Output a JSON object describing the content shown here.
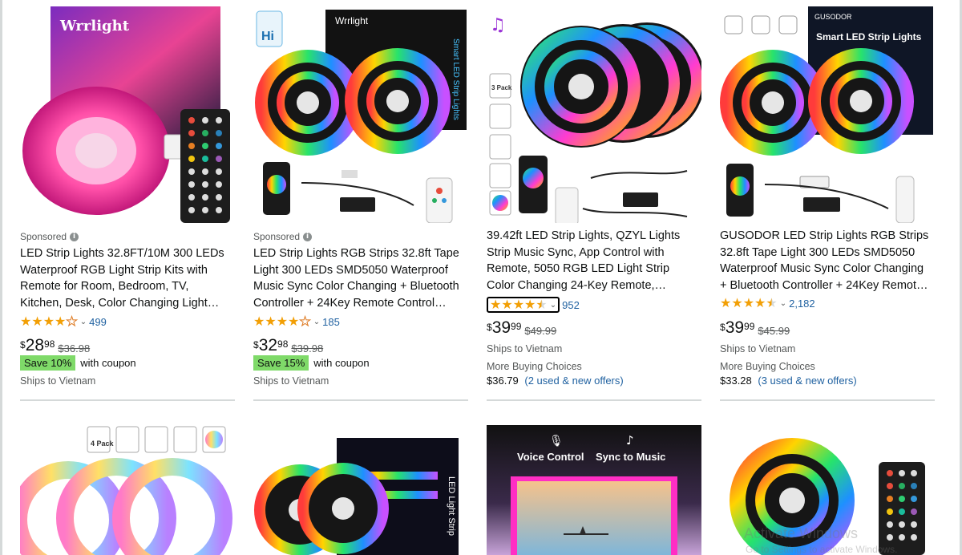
{
  "products": [
    {
      "brand_text": "Wrrlight",
      "sponsored": "Sponsored",
      "title": "LED Strip Lights 32.8FT/10M 300 LEDs Waterproof RGB Light Strip Kits with Remote for Room, Bedroom, TV, Kitchen, Desk, Color Changing Light…",
      "rating": 4.0,
      "review_count": "499",
      "price_symbol": "$",
      "price_whole": "28",
      "price_fraction": "98",
      "list_price": "$36.98",
      "coupon_badge": "Save 10%",
      "coupon_text": "with coupon",
      "ships": "Ships to Vietnam"
    },
    {
      "brand_text": "Wrrlight",
      "badge_text": "Hi",
      "box_text": "Smart LED Strip Lights",
      "sponsored": "Sponsored",
      "title": "LED Strip Lights RGB Strips 32.8ft Tape Light 300 LEDs SMD5050 Waterproof Music Sync Color Changing + Bluetooth Controller + 24Key Remote Control…",
      "rating": 4.0,
      "review_count": "185",
      "price_symbol": "$",
      "price_whole": "32",
      "price_fraction": "98",
      "list_price": "$39.98",
      "coupon_badge": "Save 15%",
      "coupon_text": "with coupon",
      "ships": "Ships to Vietnam"
    },
    {
      "pack_badge": "3 Pack",
      "title": "39.42ft LED Strip Lights, QZYL Lights Strip Music Sync, App Control with Remote, 5050 RGB LED Light Strip Color Changing 24-Key Remote,…",
      "rating": 4.5,
      "review_count": "952",
      "price_symbol": "$",
      "price_whole": "39",
      "price_fraction": "99",
      "list_price": "$49.99",
      "ships": "Ships to Vietnam",
      "more_buying": "More Buying Choices",
      "offer_price": "$36.79",
      "offers_link": "(2 used & new offers)"
    },
    {
      "brand_text": "GUSODOR",
      "box_text": "Smart LED Strip Lights",
      "title": "GUSODOR LED Strip Lights RGB Strips 32.8ft Tape Light 300 LEDs SMD5050 Waterproof Music Sync Color Changing + Bluetooth Controller + 24Key Remot…",
      "rating": 4.5,
      "review_count": "2,182",
      "price_symbol": "$",
      "price_whole": "39",
      "price_fraction": "99",
      "list_price": "$45.99",
      "ships": "Ships to Vietnam",
      "more_buying": "More Buying Choices",
      "offer_price": "$33.28",
      "offers_link": "(3 used & new offers)"
    }
  ],
  "row2": [
    {
      "pack_badge": "4 Pack"
    },
    {
      "box_text": "LED Light Strip"
    },
    {
      "voice_label": "Voice Control",
      "music_label": "Sync to Music"
    },
    {}
  ],
  "watermark": {
    "line1": "Activate Windows",
    "line2": "Go to Settings to activate Windows."
  },
  "colors": {
    "link": "#2162a1",
    "star": "#f29f05",
    "coupon": "#7fda69",
    "divider": "#d5d9d9"
  }
}
